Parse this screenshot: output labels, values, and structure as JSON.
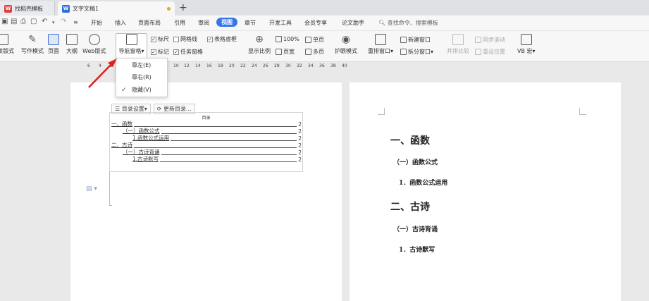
{
  "tabs": [
    {
      "label": "找稻壳模板",
      "icon": "wps-logo-icon"
    },
    {
      "label": "文字文稿1",
      "icon": "document-icon",
      "unsaved": true
    }
  ],
  "menu": {
    "items": [
      "开始",
      "插入",
      "页面布局",
      "引用",
      "审阅",
      "视图",
      "章节",
      "开发工具",
      "会员专享",
      "论文助手"
    ],
    "active": "视图",
    "search_placeholder": "查找命令、搜索模板"
  },
  "ribbon": {
    "read_mode": "阅读版式",
    "write_mode": "写作模式",
    "page": "页面",
    "outline": "大纲",
    "web_layout": "Web版式",
    "nav_pane": "导航窗格",
    "ruler": "标尺",
    "gridlines": "网格线",
    "table_gridlines": "表格虚框",
    "mark": "标记",
    "taskpane": "任务窗格",
    "zoom_label": "显示比例",
    "zoom_value": "100%",
    "single_page": "单页",
    "page_width": "页宽",
    "multi_page": "多页",
    "eye_mode": "护眼模式",
    "rearrange_window": "重排窗口",
    "new_window": "新建窗口",
    "split_window": "拆分窗口",
    "side_by_side": "并排比较",
    "sync_scroll": "同步滚动",
    "reset_position": "重设位置",
    "vb_macro": "VB 宏",
    "checks": {
      "ruler": true,
      "gridlines": false,
      "table_gridlines": true,
      "mark": true,
      "taskpane": true
    }
  },
  "dropdown": {
    "items": [
      {
        "label": "靠左(E)",
        "checked": false
      },
      {
        "label": "靠右(R)",
        "checked": false
      },
      {
        "label": "隐藏(V)",
        "checked": true
      }
    ]
  },
  "ruler_ticks": [
    "6",
    "4",
    "2",
    "2",
    "4",
    "6",
    "8",
    "10",
    "12",
    "14",
    "16",
    "18",
    "20",
    "22",
    "24",
    "26",
    "28",
    "30",
    "32",
    "34",
    "36",
    "38",
    "40"
  ],
  "toc": {
    "settings_label": "目录设置",
    "update_label": "更新目录...",
    "title": "目录",
    "entries": [
      {
        "text": "一、函数",
        "page": "2"
      },
      {
        "text": "（一）函数公式",
        "page": "2"
      },
      {
        "text": "1.函数公式运用",
        "page": "2"
      },
      {
        "text": "二、古诗",
        "page": "2"
      },
      {
        "text": "（一）古诗背诵",
        "page": "2"
      },
      {
        "text": "1.古诗默写",
        "page": "2"
      }
    ]
  },
  "document": {
    "h1_a": "一、函数",
    "h2_a": "（一）函数公式",
    "h3_a": "1．函数公式运用",
    "h1_b": "二、古诗",
    "h2_b": "（一）古诗背诵",
    "h3_b": "1．古诗默写"
  },
  "colors": {
    "accent": "#3876e8",
    "arrow": "#e02020"
  }
}
